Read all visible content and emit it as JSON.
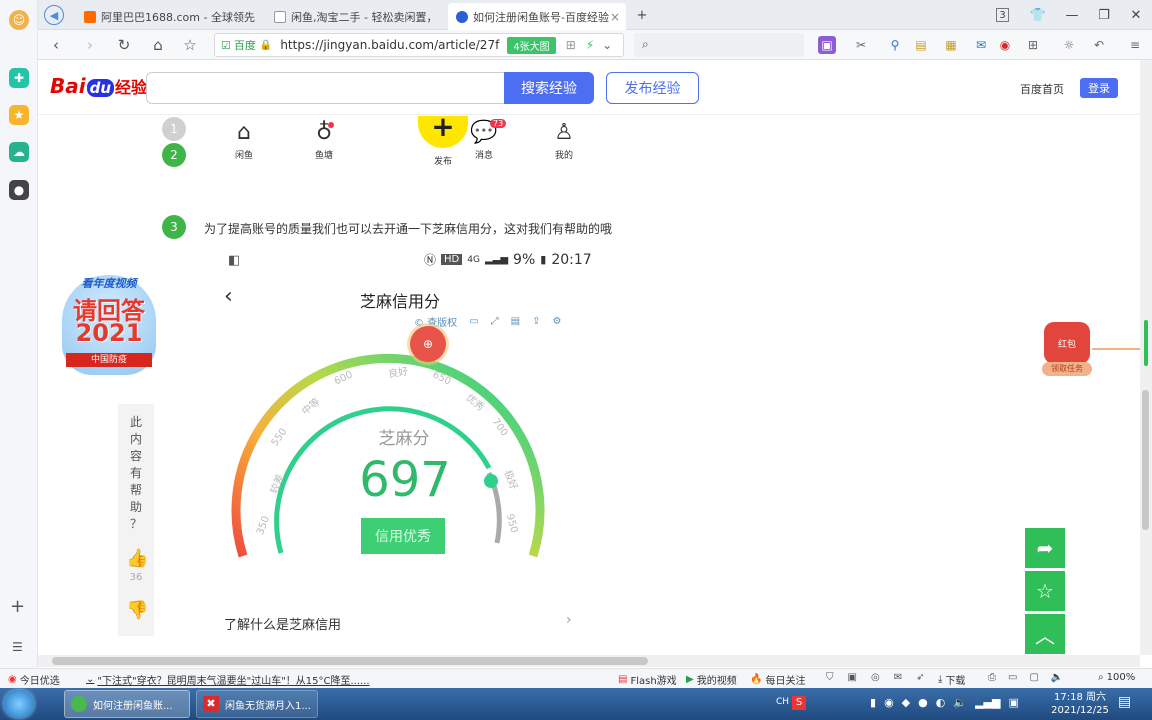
{
  "browser": {
    "tabs": [
      {
        "label": "阿里巴巴1688.com - 全球领先"
      },
      {
        "label": "闲鱼,淘宝二手 - 轻松卖闲置，"
      },
      {
        "label": "如何注册闲鱼账号-百度经验"
      }
    ],
    "tab_count": "3",
    "url_secure_label": "百度",
    "url": "https://jingyan.baidu.com/article/27f",
    "url_badge": "4张大图"
  },
  "site": {
    "logo_text": "Bai",
    "logo_du": "du",
    "logo_suffix": "经验",
    "search_button": "搜索经验",
    "publish_button": "发布经验",
    "home_link": "百度首页",
    "login_button": "登录"
  },
  "article": {
    "steps": [
      "1",
      "2",
      "3"
    ],
    "step3_text": "为了提高账号的质量我们也可以去开通一下芝麻信用分，这对我们有帮助的哦",
    "phone_nav": [
      {
        "label": "闲鱼",
        "icon": "home-icon"
      },
      {
        "label": "鱼塘",
        "icon": "pond-icon"
      },
      {
        "label": "发布",
        "icon": "plus-icon"
      },
      {
        "label": "消息",
        "icon": "message-icon",
        "badge": "73"
      },
      {
        "label": "我的",
        "icon": "user-icon"
      }
    ],
    "phone_status": {
      "network": "4G",
      "battery": "9%",
      "time": "20:17",
      "hd": "HD"
    },
    "phone_title": "芝麻信用分",
    "image_tools": {
      "copyright": "查版权"
    },
    "gauge": {
      "label": "芝麻分",
      "score": "697",
      "score_value": 697,
      "range": [
        350,
        950
      ],
      "badge": "信用优秀",
      "ticks": [
        "350",
        "550",
        "600",
        "650",
        "700",
        "950"
      ],
      "levels": [
        "较差",
        "中等",
        "良好",
        "优秀",
        "极好"
      ]
    },
    "learn_more": "了解什么是芝麻信用"
  },
  "feedback": {
    "question": [
      "此",
      "内",
      "容",
      "有",
      "帮",
      "助",
      "？"
    ],
    "like_count": "36"
  },
  "promo": {
    "top": "看年度视频",
    "main": "请回答",
    "year": "2021",
    "sub": "中国防疫"
  },
  "redpacket": {
    "label": "红包",
    "sub": "领取任务"
  },
  "statusbar": {
    "left": "今日优选",
    "news": "\"下注式\"穿衣？昆明周末气温要坐\"过山车\"！从15°C降至......",
    "flash": "Flash游戏",
    "video": "我的视频",
    "follow": "每日关注",
    "download": "下载",
    "zoom": "100%"
  },
  "taskbar": {
    "items": [
      "如何注册闲鱼账...",
      "闲鱼无货源月入1..."
    ],
    "ime": "CH",
    "time": "17:18 周六",
    "date": "2021/12/25"
  }
}
